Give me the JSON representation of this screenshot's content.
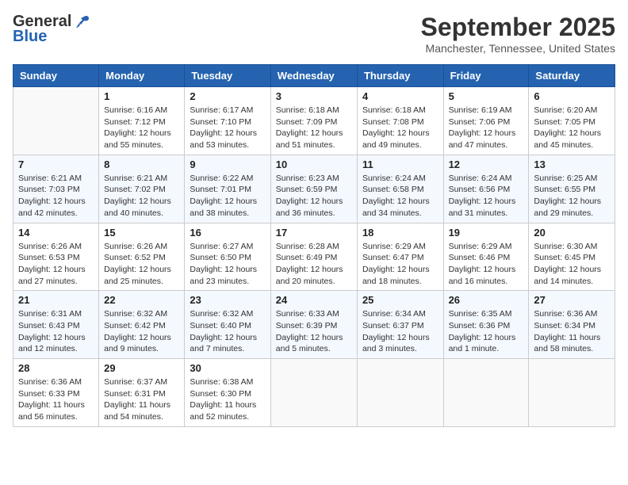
{
  "header": {
    "logo_general": "General",
    "logo_blue": "Blue",
    "month": "September 2025",
    "location": "Manchester, Tennessee, United States"
  },
  "days_of_week": [
    "Sunday",
    "Monday",
    "Tuesday",
    "Wednesday",
    "Thursday",
    "Friday",
    "Saturday"
  ],
  "weeks": [
    [
      {
        "day": "",
        "info": ""
      },
      {
        "day": "1",
        "info": "Sunrise: 6:16 AM\nSunset: 7:12 PM\nDaylight: 12 hours\nand 55 minutes."
      },
      {
        "day": "2",
        "info": "Sunrise: 6:17 AM\nSunset: 7:10 PM\nDaylight: 12 hours\nand 53 minutes."
      },
      {
        "day": "3",
        "info": "Sunrise: 6:18 AM\nSunset: 7:09 PM\nDaylight: 12 hours\nand 51 minutes."
      },
      {
        "day": "4",
        "info": "Sunrise: 6:18 AM\nSunset: 7:08 PM\nDaylight: 12 hours\nand 49 minutes."
      },
      {
        "day": "5",
        "info": "Sunrise: 6:19 AM\nSunset: 7:06 PM\nDaylight: 12 hours\nand 47 minutes."
      },
      {
        "day": "6",
        "info": "Sunrise: 6:20 AM\nSunset: 7:05 PM\nDaylight: 12 hours\nand 45 minutes."
      }
    ],
    [
      {
        "day": "7",
        "info": "Sunrise: 6:21 AM\nSunset: 7:03 PM\nDaylight: 12 hours\nand 42 minutes."
      },
      {
        "day": "8",
        "info": "Sunrise: 6:21 AM\nSunset: 7:02 PM\nDaylight: 12 hours\nand 40 minutes."
      },
      {
        "day": "9",
        "info": "Sunrise: 6:22 AM\nSunset: 7:01 PM\nDaylight: 12 hours\nand 38 minutes."
      },
      {
        "day": "10",
        "info": "Sunrise: 6:23 AM\nSunset: 6:59 PM\nDaylight: 12 hours\nand 36 minutes."
      },
      {
        "day": "11",
        "info": "Sunrise: 6:24 AM\nSunset: 6:58 PM\nDaylight: 12 hours\nand 34 minutes."
      },
      {
        "day": "12",
        "info": "Sunrise: 6:24 AM\nSunset: 6:56 PM\nDaylight: 12 hours\nand 31 minutes."
      },
      {
        "day": "13",
        "info": "Sunrise: 6:25 AM\nSunset: 6:55 PM\nDaylight: 12 hours\nand 29 minutes."
      }
    ],
    [
      {
        "day": "14",
        "info": "Sunrise: 6:26 AM\nSunset: 6:53 PM\nDaylight: 12 hours\nand 27 minutes."
      },
      {
        "day": "15",
        "info": "Sunrise: 6:26 AM\nSunset: 6:52 PM\nDaylight: 12 hours\nand 25 minutes."
      },
      {
        "day": "16",
        "info": "Sunrise: 6:27 AM\nSunset: 6:50 PM\nDaylight: 12 hours\nand 23 minutes."
      },
      {
        "day": "17",
        "info": "Sunrise: 6:28 AM\nSunset: 6:49 PM\nDaylight: 12 hours\nand 20 minutes."
      },
      {
        "day": "18",
        "info": "Sunrise: 6:29 AM\nSunset: 6:47 PM\nDaylight: 12 hours\nand 18 minutes."
      },
      {
        "day": "19",
        "info": "Sunrise: 6:29 AM\nSunset: 6:46 PM\nDaylight: 12 hours\nand 16 minutes."
      },
      {
        "day": "20",
        "info": "Sunrise: 6:30 AM\nSunset: 6:45 PM\nDaylight: 12 hours\nand 14 minutes."
      }
    ],
    [
      {
        "day": "21",
        "info": "Sunrise: 6:31 AM\nSunset: 6:43 PM\nDaylight: 12 hours\nand 12 minutes."
      },
      {
        "day": "22",
        "info": "Sunrise: 6:32 AM\nSunset: 6:42 PM\nDaylight: 12 hours\nand 9 minutes."
      },
      {
        "day": "23",
        "info": "Sunrise: 6:32 AM\nSunset: 6:40 PM\nDaylight: 12 hours\nand 7 minutes."
      },
      {
        "day": "24",
        "info": "Sunrise: 6:33 AM\nSunset: 6:39 PM\nDaylight: 12 hours\nand 5 minutes."
      },
      {
        "day": "25",
        "info": "Sunrise: 6:34 AM\nSunset: 6:37 PM\nDaylight: 12 hours\nand 3 minutes."
      },
      {
        "day": "26",
        "info": "Sunrise: 6:35 AM\nSunset: 6:36 PM\nDaylight: 12 hours\nand 1 minute."
      },
      {
        "day": "27",
        "info": "Sunrise: 6:36 AM\nSunset: 6:34 PM\nDaylight: 11 hours\nand 58 minutes."
      }
    ],
    [
      {
        "day": "28",
        "info": "Sunrise: 6:36 AM\nSunset: 6:33 PM\nDaylight: 11 hours\nand 56 minutes."
      },
      {
        "day": "29",
        "info": "Sunrise: 6:37 AM\nSunset: 6:31 PM\nDaylight: 11 hours\nand 54 minutes."
      },
      {
        "day": "30",
        "info": "Sunrise: 6:38 AM\nSunset: 6:30 PM\nDaylight: 11 hours\nand 52 minutes."
      },
      {
        "day": "",
        "info": ""
      },
      {
        "day": "",
        "info": ""
      },
      {
        "day": "",
        "info": ""
      },
      {
        "day": "",
        "info": ""
      }
    ]
  ]
}
